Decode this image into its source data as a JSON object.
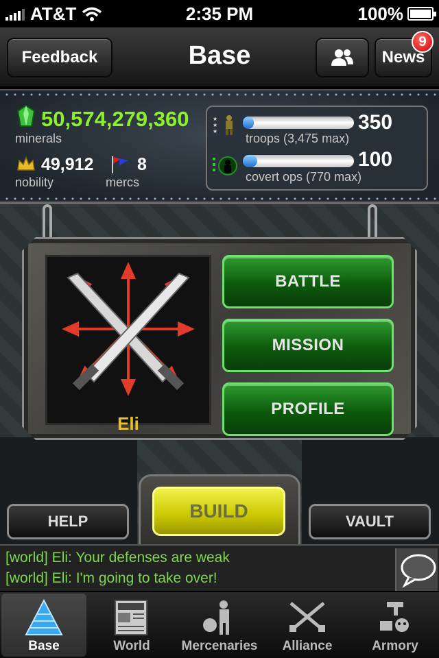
{
  "status_bar": {
    "carrier": "AT&T",
    "time": "2:35 PM",
    "battery": "100%"
  },
  "nav": {
    "feedback_label": "Feedback",
    "title": "Base",
    "news_label": "News",
    "news_badge": "9"
  },
  "stats": {
    "minerals_value": "50,574,279,360",
    "minerals_label": "minerals",
    "nobility_value": "49,912",
    "nobility_label": "nobility",
    "mercs_value": "8",
    "mercs_label": "mercs",
    "troops_value": "350",
    "troops_label": "troops (3,475 max)",
    "troops_fill": 0.1,
    "covert_value": "100",
    "covert_label": "covert ops (770 max)",
    "covert_fill": 0.13
  },
  "profile": {
    "name": "Eli"
  },
  "actions": {
    "battle": "BATTLE",
    "mission": "MISSION",
    "profile": "PROFILE"
  },
  "bottom_buttons": {
    "help": "HELP",
    "build": "BUILD",
    "vault": "VAULT"
  },
  "chat": {
    "lines": [
      "[world] Eli: Your defenses are weak",
      "[world] Eli: I'm going to take over!"
    ]
  },
  "tabs": [
    {
      "label": "Base",
      "icon": "pyramid-icon",
      "active": true
    },
    {
      "label": "World",
      "icon": "newspaper-icon",
      "active": false
    },
    {
      "label": "Mercenaries",
      "icon": "mercenary-icon",
      "active": false
    },
    {
      "label": "Alliance",
      "icon": "crossed-rifles-icon",
      "active": false
    },
    {
      "label": "Armory",
      "icon": "armory-icon",
      "active": false
    }
  ],
  "colors": {
    "minerals": "#8cf02a",
    "chat": "#7cd84a",
    "name": "#e6c22a",
    "action_green": "#0c5a0c",
    "build_yellow": "#c9c800"
  }
}
